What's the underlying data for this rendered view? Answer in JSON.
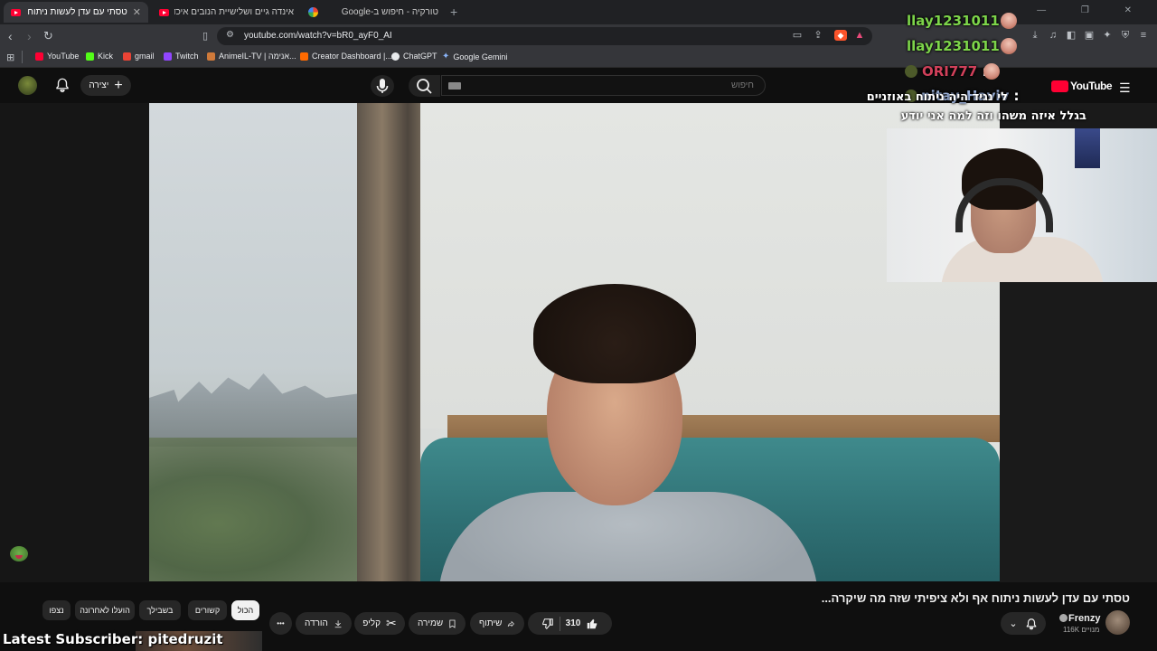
{
  "browser": {
    "tabs": [
      {
        "title": "טסתי עם עדן לעשות ניתוח אף ולא",
        "close": "✕",
        "favicon": "youtube-icon",
        "active": true
      },
      {
        "title": "אינדה גיים ושלישיית הנובים איכדו את",
        "favicon": "youtube-icon",
        "active": false
      },
      {
        "title": "טורקיה - חיפוש ב-Google",
        "favicon": "google-icon",
        "active": false
      }
    ],
    "new_tab": "+",
    "window_controls": "— ❐ ✕",
    "url": "youtube.com/watch?v=bR0_ayF0_AI",
    "bookmarks": [
      {
        "label": "YouTube",
        "color": "#ff0033"
      },
      {
        "label": "Kick",
        "color": "#53fc18"
      },
      {
        "label": "gmail",
        "color": "#ea4335"
      },
      {
        "label": "Twitch",
        "color": "#9146ff"
      },
      {
        "label": "AnimeIL-TV | אנימה...",
        "color": "#d07a3a"
      },
      {
        "label": "Creator Dashboard |...",
        "color": "#ff6a00"
      },
      {
        "label": "ChatGPT",
        "color": "#e8eaed"
      },
      {
        "label": "Google Gemini",
        "color": "#8ab4f8"
      }
    ]
  },
  "youtube": {
    "create_label": "יצירה",
    "search_placeholder": "חיפוש",
    "video_title": "טסתי עם עדן לעשות ניתוח אף ולא ציפיתי שזה מה שיקרה...",
    "channel_name": "Frenzy",
    "subscribers": "116K מנויים",
    "likes": "310",
    "share_label": "שיתוף",
    "save_label": "שמירה",
    "clip_label": "קליפ",
    "download_label": "הורדה",
    "more_label": "•••",
    "chips": {
      "all": "הכול",
      "related": "קשורים",
      "foryou": "בשבילך",
      "recent": "הועלו לאחרונה",
      "watched": "נצפו"
    },
    "accent": "#ff0033"
  },
  "stream_overlay": {
    "chat": [
      {
        "user": "llay1231011",
        "sep": ":",
        "color": "#7dd54a"
      },
      {
        "user": "llay1231011",
        "sep": ":",
        "color": "#7dd54a"
      },
      {
        "user": "ORI777",
        "sep": ":",
        "color": "#d0405a"
      },
      {
        "user": "nitay_Haviv",
        "sep": ":",
        "message": "לי נגיד היה ניתוח באוזניים",
        "color": "#9fb6e0"
      },
      {
        "message": "בגלל איזה משהו וזה למה אני יודע",
        "color": "#ffffff"
      }
    ],
    "chat_logo": "YouTube",
    "latest_subscriber": "Latest Subscriber: pitedruzit"
  }
}
